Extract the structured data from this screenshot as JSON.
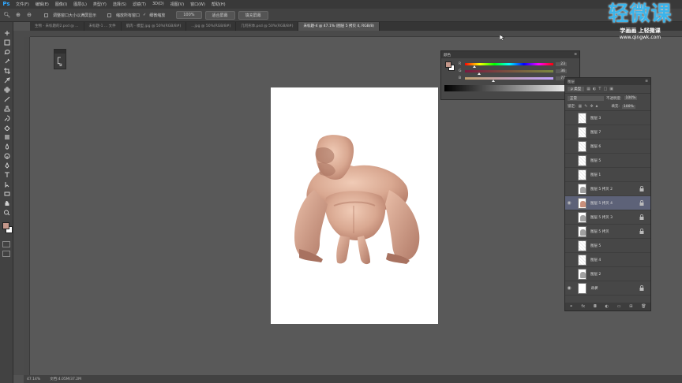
{
  "app": {
    "logo": "Ps"
  },
  "menu": [
    "文件(F)",
    "编辑(E)",
    "图像(I)",
    "图层(L)",
    "类型(Y)",
    "选择(S)",
    "滤镜(T)",
    "3D(D)",
    "视图(V)",
    "窗口(W)",
    "帮助(H)"
  ],
  "options": {
    "zoom_icon": "zoom-icon",
    "resize_windows": "调整窗口大小以满屏显示",
    "zoom_all": "缩放所有窗口",
    "scrubby_zoom": "细微缩放",
    "btn_100": "100%",
    "btn_fit": "适合屏幕",
    "btn_fill": "填充屏幕"
  },
  "tabs": [
    {
      "label": "生物 - 未标题的2.psd @ ...",
      "active": false
    },
    {
      "label": "未标题-1 ... 文件",
      "active": false
    },
    {
      "label": "肌肉 - 模型.jpg @ 50%(RGB/8#)",
      "active": false
    },
    {
      "label": "...jpg @ 50%(RGB/8#)",
      "active": false
    },
    {
      "label": "几何形体.psd @ 50%(RGB/8#)",
      "active": false
    },
    {
      "label": "未标题-4 @ 47.1% (图层 5 拷贝 4, RGB/8)",
      "active": true
    }
  ],
  "status": {
    "zoom": "47.14%",
    "doc": "文档:4.05M/37.2M"
  },
  "color_panel": {
    "title": "颜色",
    "channels": [
      {
        "label": "R",
        "value": "23",
        "fill": 0.09,
        "gradient": "rainbow"
      },
      {
        "label": "G",
        "value": "36",
        "fill": 0.14,
        "gradient": "green"
      },
      {
        "label": "B",
        "value": "77",
        "fill": 0.3,
        "gradient": "blue"
      }
    ],
    "colors": {
      "foreground": "#c4978a",
      "background": "#ffffff"
    }
  },
  "layers_panel": {
    "title": "图层",
    "filter_label": "ρ 类型",
    "blend_mode": "正常",
    "opacity_label": "不透明度:",
    "opacity_value": "100%",
    "lock_label": "锁定:",
    "fill_label": "填充:",
    "fill_value": "100%",
    "layers": [
      {
        "name": "图层 3",
        "visible": false,
        "selected": false,
        "locked": false,
        "thumb": "sketch"
      },
      {
        "name": "图层 7",
        "visible": false,
        "selected": false,
        "locked": false,
        "thumb": "sketch"
      },
      {
        "name": "图层 6",
        "visible": false,
        "selected": false,
        "locked": false,
        "thumb": "sketch"
      },
      {
        "name": "图层 5",
        "visible": false,
        "selected": false,
        "locked": false,
        "thumb": "sketch"
      },
      {
        "name": "图层 1",
        "visible": false,
        "selected": false,
        "locked": false,
        "thumb": "sketch"
      },
      {
        "name": "图层 5 拷贝 2",
        "visible": false,
        "selected": false,
        "locked": true,
        "thumb": "figure"
      },
      {
        "name": "图层 5 拷贝 4",
        "visible": true,
        "selected": true,
        "locked": true,
        "thumb": "figure-color"
      },
      {
        "name": "图层 5 拷贝 3",
        "visible": false,
        "selected": false,
        "locked": true,
        "thumb": "figure"
      },
      {
        "name": "图层 5 拷贝",
        "visible": false,
        "selected": false,
        "locked": true,
        "thumb": "figure"
      },
      {
        "name": "图层 5",
        "visible": false,
        "selected": false,
        "locked": false,
        "thumb": "sketch"
      },
      {
        "name": "图层 4",
        "visible": false,
        "selected": false,
        "locked": false,
        "thumb": "sketch"
      },
      {
        "name": "图层 2",
        "visible": false,
        "selected": false,
        "locked": false,
        "thumb": "figure"
      },
      {
        "name": "背景",
        "visible": true,
        "selected": false,
        "locked": true,
        "thumb": "white"
      }
    ]
  },
  "watermark": {
    "brand": "轻微课",
    "slogan": "学画画 上轻微课",
    "url": "www.qingwk.com"
  },
  "tool_icons": [
    "move-tool-icon",
    "marquee-tool-icon",
    "lasso-tool-icon",
    "quick-select-tool-icon",
    "crop-tool-icon",
    "eyedropper-tool-icon",
    "healing-brush-tool-icon",
    "brush-tool-icon",
    "clone-stamp-tool-icon",
    "history-brush-tool-icon",
    "eraser-tool-icon",
    "gradient-tool-icon",
    "blur-tool-icon",
    "dodge-tool-icon",
    "pen-tool-icon",
    "type-tool-icon",
    "path-select-tool-icon",
    "shape-tool-icon",
    "hand-tool-icon",
    "zoom-tool-icon"
  ]
}
